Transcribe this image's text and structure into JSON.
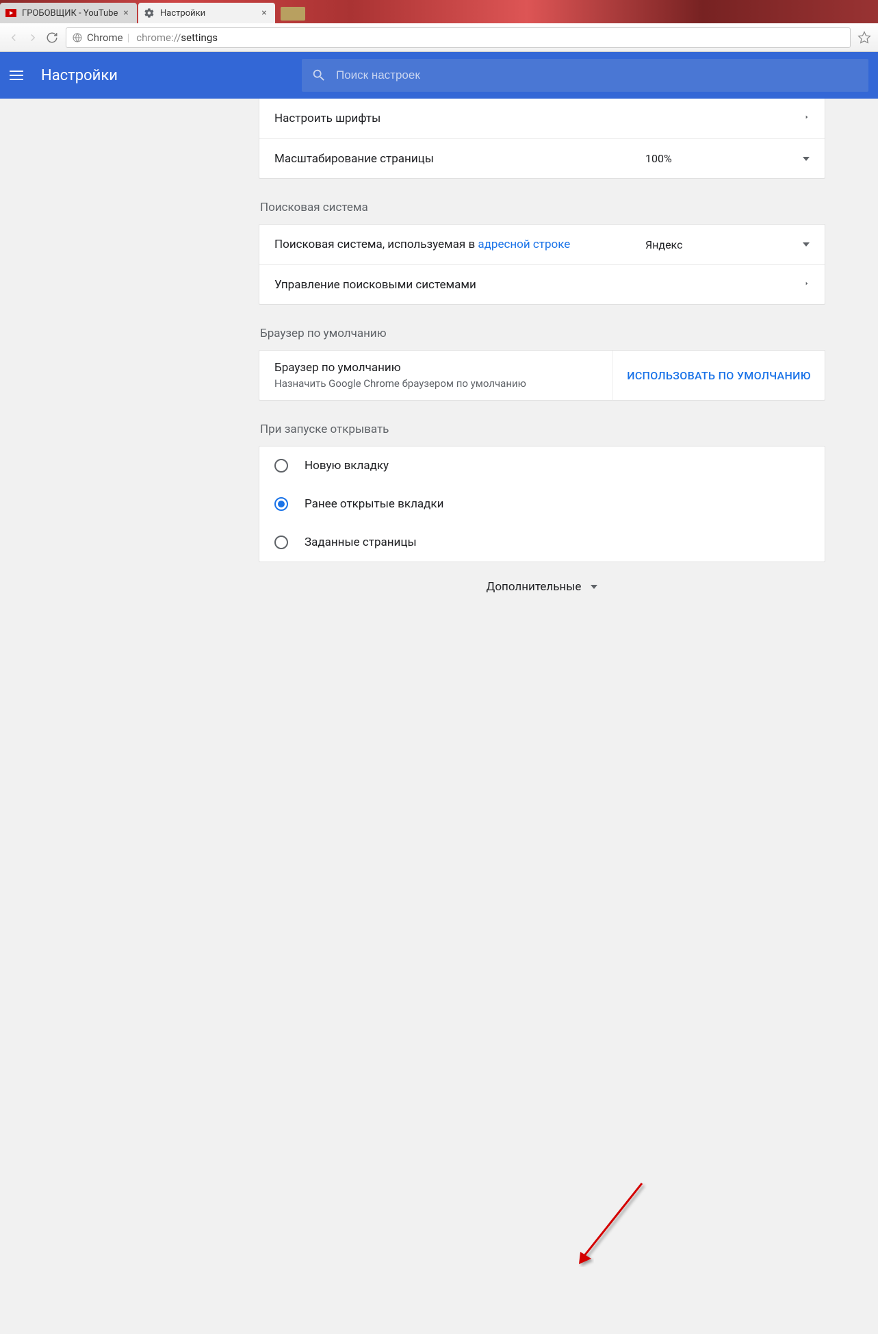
{
  "tabs": {
    "t0": {
      "title": "ГРОБОВЩИК - YouTube"
    },
    "t1": {
      "title": "Настройки"
    }
  },
  "omnibox": {
    "chip": "Chrome",
    "url_prefix": "chrome://",
    "url_path": "settings"
  },
  "header": {
    "title": "Настройки",
    "search_placeholder": "Поиск настроек"
  },
  "appearance": {
    "customize_fonts": "Настроить шрифты",
    "page_zoom_label": "Масштабирование страницы",
    "page_zoom_value": "100%"
  },
  "search_engine": {
    "section": "Поисковая система",
    "used_in_prefix": "Поисковая система, используемая в ",
    "used_in_link": "адресной строке",
    "selected": "Яндекс",
    "manage": "Управление поисковыми системами"
  },
  "default_browser": {
    "section": "Браузер по умолчанию",
    "title": "Браузер по умолчанию",
    "desc": "Назначить Google Chrome браузером по умолчанию",
    "button": "ИСПОЛЬЗОВАТЬ ПО УМОЛЧАНИЮ"
  },
  "on_startup": {
    "section": "При запуске открывать",
    "opt1": "Новую вкладку",
    "opt2": "Ранее открытые вкладки",
    "opt3": "Заданные страницы"
  },
  "advanced": "Дополнительные"
}
